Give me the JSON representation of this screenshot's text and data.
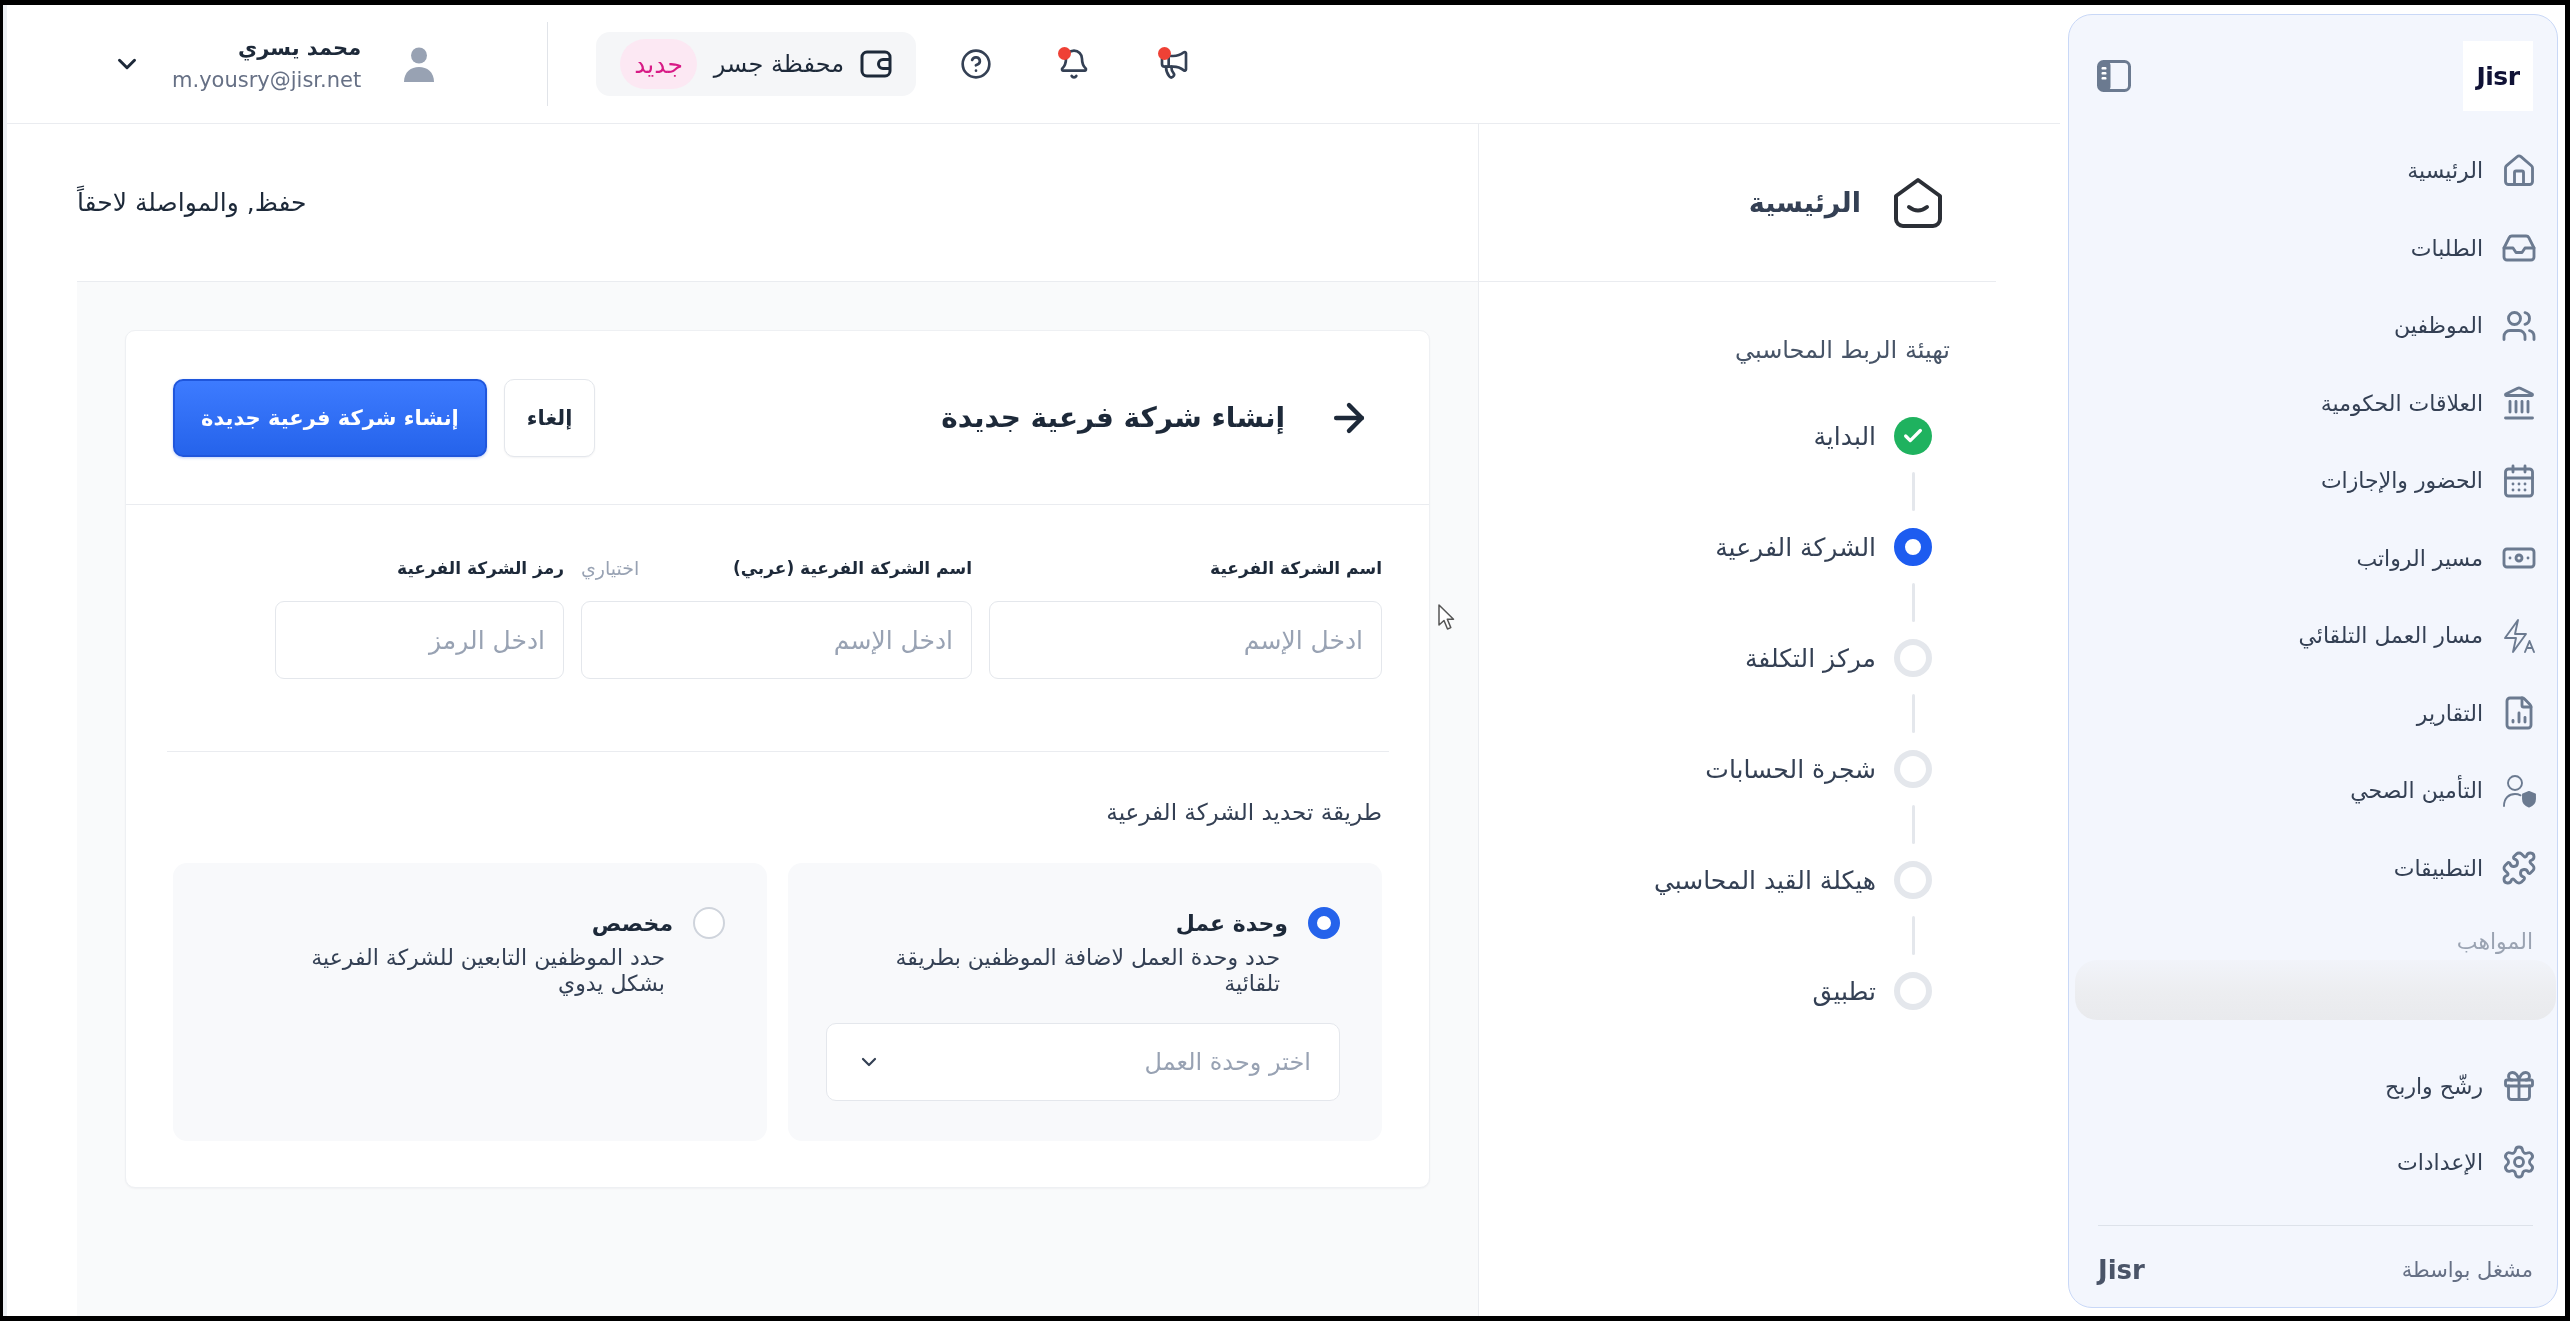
{
  "sidebar": {
    "logo": "Jisr",
    "nav_items": [
      {
        "label": "الرئيسية"
      },
      {
        "label": "الطلبات"
      },
      {
        "label": "الموظفين"
      },
      {
        "label": "العلاقات الحكومية"
      },
      {
        "label": "الحضور والإجازات"
      },
      {
        "label": "مسير الرواتب"
      },
      {
        "label": "مسار العمل التلقائي"
      },
      {
        "label": "التقارير"
      },
      {
        "label": "التأمين الصحي"
      },
      {
        "label": "التطبيقات"
      }
    ],
    "section_label": "المواهب",
    "bottom_items": [
      {
        "label": "رشّح واربح"
      },
      {
        "label": "الإعدادات"
      }
    ],
    "footer": {
      "text": "مشغل بواسطة",
      "logo": "Jisr"
    }
  },
  "header": {
    "actions": [
      {
        "kind": "announcements",
        "unread": true
      },
      {
        "kind": "notifications",
        "unread": true
      },
      {
        "kind": "help",
        "unread": false
      }
    ],
    "wallet": {
      "label": "محفظة جسر",
      "badge": "جديد"
    },
    "user": {
      "name": "محمد يسري",
      "email": "m.yousry@jisr.net"
    }
  },
  "steps_panel": {
    "title": "الرئيسية",
    "subtitle": "تهيئة الربط المحاسبي",
    "steps": [
      {
        "label": "البداية",
        "completed": true,
        "selected": false
      },
      {
        "label": "الشركة الفرعية",
        "completed": false,
        "selected": true
      },
      {
        "label": "مركز التكلفة",
        "completed": false,
        "selected": false
      },
      {
        "label": "شجرة الحسابات",
        "completed": false,
        "selected": false
      },
      {
        "label": "هيكلة القيد المحاسبي",
        "completed": false,
        "selected": false
      },
      {
        "label": "تطبيق",
        "completed": false,
        "selected": false
      }
    ]
  },
  "page_header": {
    "save_link": "حفظ, والمواصلة لاحقاً"
  },
  "form": {
    "title": "إنشاء شركة فرعية جديدة",
    "buttons": [
      {
        "label": "إلغاء",
        "kind": "secondary"
      },
      {
        "label": "إنشاء شركة فرعية جديدة",
        "kind": "primary"
      }
    ],
    "fields": [
      {
        "label": "اسم الشركة الفرعية",
        "placeholder": "ادخل الإسم"
      },
      {
        "label": "اسم الشركة الفرعية (عربي)",
        "note": "اختياري",
        "placeholder": "ادخل الإسم"
      },
      {
        "label": "رمز الشركة الفرعية",
        "placeholder": "ادخل الرمز"
      }
    ],
    "method": {
      "label": "طريقة تحديد الشركة الفرعية",
      "options": [
        {
          "title": "وحدة عمل",
          "description": "حدد وحدة العمل لاضافة الموظفين بطريقة تلقائية",
          "selected": true,
          "select_placeholder": "اختر وحدة العمل"
        },
        {
          "title": "مخصص",
          "description": "حدد الموظفين التابعين للشركة الفرعية بشكل يدوي",
          "selected": false
        }
      ]
    }
  }
}
